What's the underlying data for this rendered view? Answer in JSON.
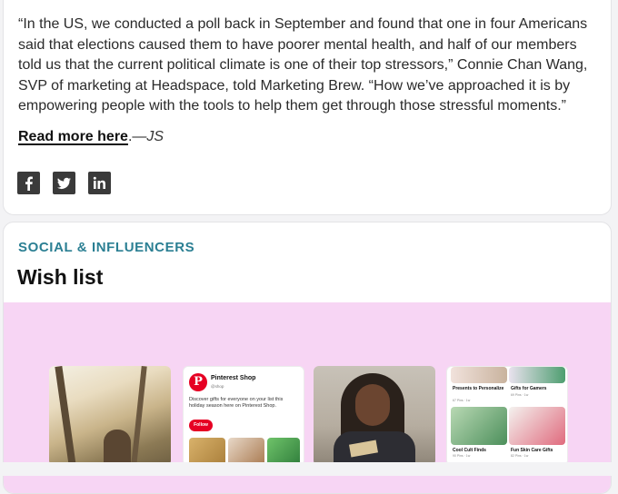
{
  "story": {
    "quote": "“In the US, we conducted a poll back in September and found that one in four Americans said that elections caused them to have poorer mental health, and half of our members told us that the current political climate is one of their top stressors,” Connie Chan Wang, SVP of marketing at Headspace, told Marketing Brew. “How we’ve approached it is by empowering people with the tools to help them get through those stressful moments.”",
    "read_more": "Read more here",
    "read_more_suffix": ".—",
    "signature": "JS"
  },
  "share": {
    "icons": [
      "facebook-icon",
      "twitter-icon",
      "linkedin-icon"
    ]
  },
  "section2": {
    "category": "SOCIAL & INFLUENCERS",
    "headline": "Wish list",
    "accent_color": "#2b7f93",
    "background_color": "#f7d5f4"
  },
  "pinterest_tile": {
    "shop_name": "Pinterest Shop",
    "handle": "@shop",
    "description": "Discover gifts for everyone on your list this holiday season here on Pinterest Shop.",
    "follow_label": "Follow"
  },
  "boards_tile": {
    "boards": [
      {
        "name": "Presents to Personalize",
        "meta": "67 Pins · 1w"
      },
      {
        "name": "Gifts for Gamers",
        "meta": "69 Pins · 1w"
      },
      {
        "name": "Cool Cult Finds",
        "meta": "90 Pins · 1w"
      },
      {
        "name": "Fun Skin Care Gifts",
        "meta": "82 Pins · 1w"
      }
    ]
  }
}
